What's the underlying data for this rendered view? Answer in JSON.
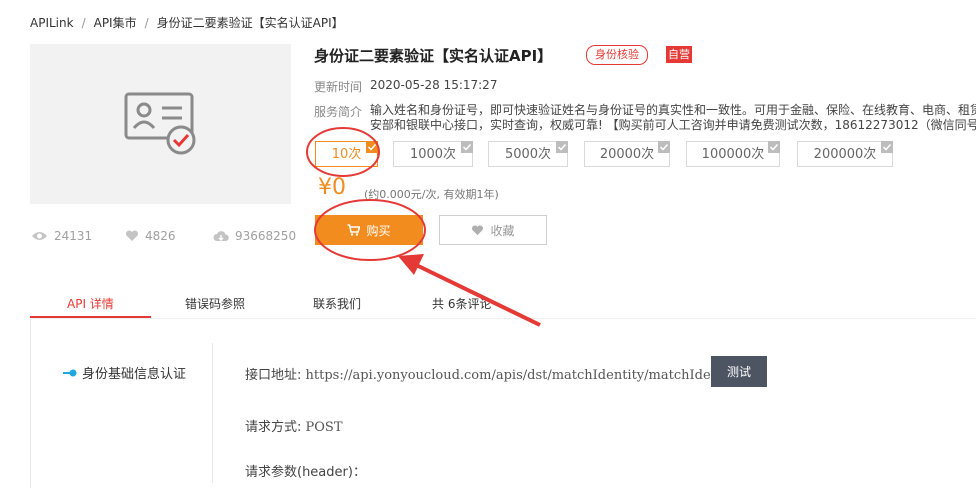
{
  "breadcrumb": [
    "APILink",
    "API集市",
    "身份证二要素验证【实名认证API】"
  ],
  "product": {
    "title": "身份证二要素验证【实名认证API】",
    "badge_outline": "身份核验",
    "badge_solid": "自营",
    "update_label": "更新时间",
    "update_value": "2020-05-28 15:17:27",
    "intro_label": "服务简介",
    "intro_line1": "输入姓名和身份证号，即可快速验证姓名与身份证号的真实性和一致性。可用于金融、保险、在线教育、电商、租赁",
    "intro_line2": "安部和银联中心接口，实时查询，权威可靠! 【购买前可人工咨询并申请免费测试次数，18612273012（微信同号）"
  },
  "stats": {
    "views": "24131",
    "likes": "4826",
    "calls": "93668250"
  },
  "options": [
    "10次",
    "1000次",
    "5000次",
    "20000次",
    "100000次",
    "200000次"
  ],
  "selected_option_index": 0,
  "price": {
    "value": "¥0",
    "note": "(约0.000元/次, 有效期1年)"
  },
  "actions": {
    "buy": "购买",
    "favorite": "收藏"
  },
  "tabs": [
    "API 详情",
    "错误码参照",
    "联系我们",
    "共 6条评论"
  ],
  "active_tab_index": 0,
  "sidebar": {
    "item": "身份基础信息认证"
  },
  "details": {
    "endpoint_label": "接口地址:",
    "endpoint_value": "https://api.yonyoucloud.com/apis/dst/matchIdentity/matchIdentity",
    "test_button": "测试",
    "method_label": "请求方式:",
    "method_value": "POST",
    "params_label": "请求参数(header)："
  },
  "colors": {
    "accent": "#f28c1f",
    "alert": "#e53935",
    "dark_button": "#4d5563"
  },
  "icons": [
    "id-card-check-icon",
    "eye-icon",
    "heart-icon",
    "cloud-download-icon",
    "cart-icon",
    "link-icon"
  ]
}
